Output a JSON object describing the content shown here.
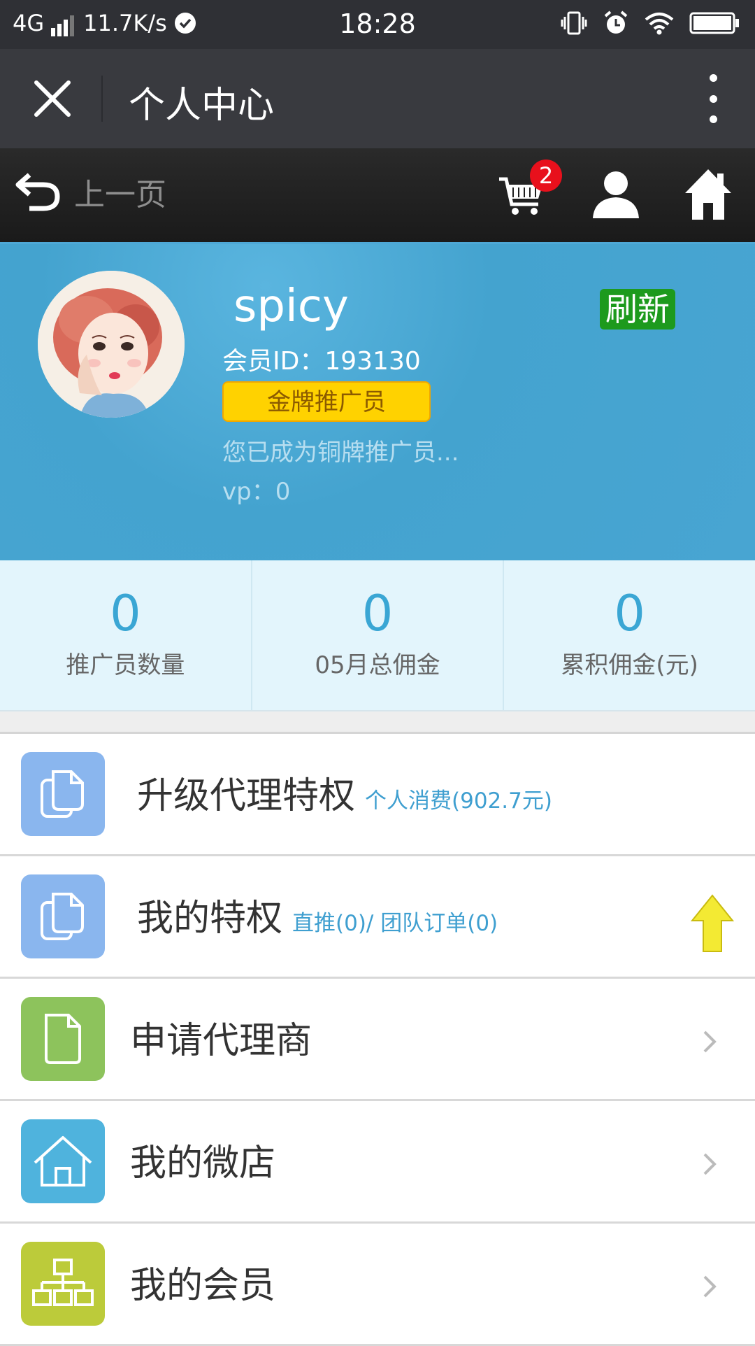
{
  "status_bar": {
    "network": "4G",
    "speed": "11.7K/s",
    "time": "18:28"
  },
  "title_bar": {
    "title": "个人中心"
  },
  "nav": {
    "back_label": "上一页",
    "cart_count": "2"
  },
  "profile": {
    "username": "spicy",
    "refresh_label": "刷新",
    "member_id": "会员ID：193130",
    "level": "金牌推广员",
    "status": "您已成为铜牌推广员...",
    "vp": "vp：0"
  },
  "stats": [
    {
      "value": "0",
      "label": "推广员数量"
    },
    {
      "value": "0",
      "label": "05月总佣金"
    },
    {
      "value": "0",
      "label": "累积佣金(元)"
    }
  ],
  "menu": [
    {
      "title": "升级代理特权",
      "sub": "个人消费(902.7元)",
      "icon": "documents-icon",
      "color": "#8ab6ee"
    },
    {
      "title": "我的特权",
      "sub": "直推(0)/ 团队订单(0)",
      "icon": "documents-icon",
      "color": "#8ab6ee"
    },
    {
      "title": "申请代理商",
      "sub": "",
      "icon": "document-icon",
      "color": "#8dc35c"
    },
    {
      "title": "我的微店",
      "sub": "",
      "icon": "house-icon",
      "color": "#4fb3dd"
    },
    {
      "title": "我的会员",
      "sub": "",
      "icon": "org-chart-icon",
      "color": "#bccb3a"
    }
  ],
  "colors": {
    "accent": "#3aa6d4",
    "header_bg": "#44a3cf",
    "refresh_green": "#1d9a1d",
    "badge_gold": "#ffd200"
  }
}
